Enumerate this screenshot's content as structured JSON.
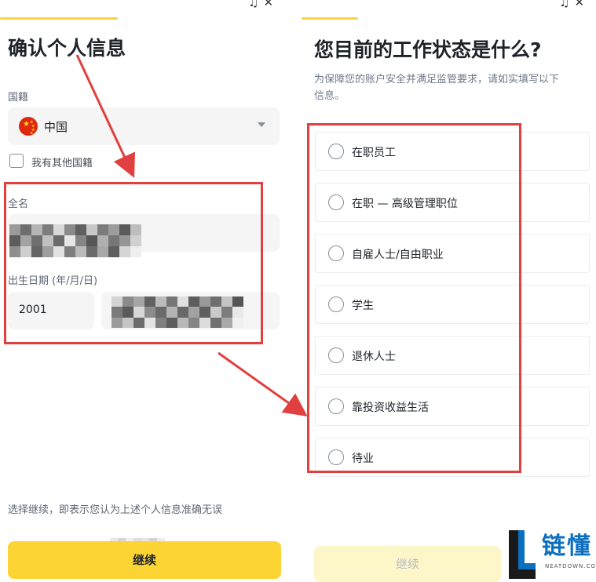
{
  "left": {
    "title": "确认个人信息",
    "nationality_label": "国籍",
    "nationality_value": "中国",
    "other_nationality": "我有其他国籍",
    "fullname_label": "全名",
    "dob_label": "出生日期 (年/月/日)",
    "dob_year": "2001",
    "disclaimer": "选择继续，即表示您认为上述个人信息准确无误",
    "continue_label": "继续"
  },
  "right": {
    "title": "您目前的工作状态是什么?",
    "subtitle_line1": "为保障您的账户安全并满足监管要求，请如实填写以下",
    "subtitle_line2": "信息。",
    "options": [
      "在职员工",
      "在职 — 高级管理职位",
      "自雇人士/自由职业",
      "学生",
      "退休人士",
      "靠投资收益生活",
      "待业"
    ],
    "continue_label": "继续"
  },
  "watermark": {
    "brand": "链懂",
    "sub": "NEATDOWN.COM"
  },
  "colors": {
    "accent": "#fcd535",
    "highlight": "#e0403f",
    "brand": "#0b6fc0"
  }
}
